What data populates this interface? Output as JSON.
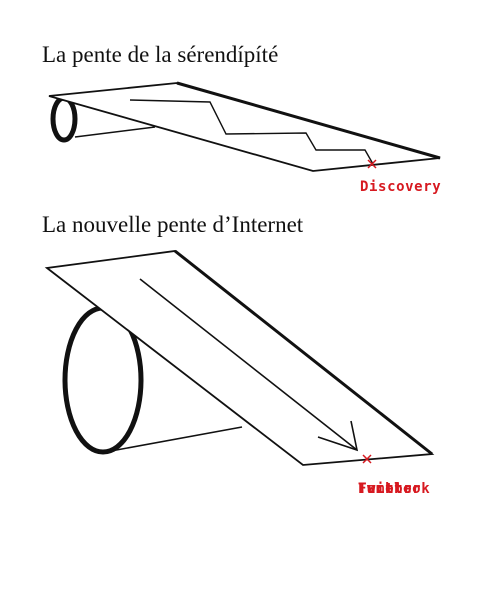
{
  "titles": {
    "top": "La pente de la sérendípíté",
    "bottom": "La nouvelle pente d’Internet"
  },
  "labels": {
    "discovery": "Discovery",
    "social_items": [
      "Facebook",
      "Twitter",
      "Tumblr",
      "..."
    ]
  },
  "colors": {
    "text": "#111111",
    "accent": "#d71920"
  }
}
